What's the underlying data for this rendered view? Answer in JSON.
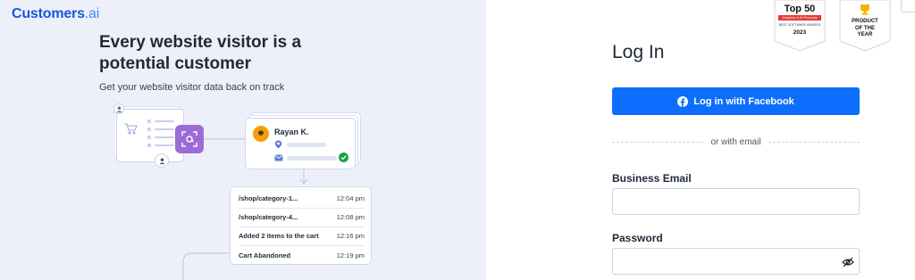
{
  "brand": {
    "name_main": "Customers",
    "name_suffix": ".ai"
  },
  "hero": {
    "headline": "Every website visitor is a potential customer",
    "subline": "Get your website visitor data back on track"
  },
  "illustration": {
    "profile_name": "Rayan K.",
    "activity_log": [
      {
        "event": "/shop/category-1...",
        "time": "12:04 pm"
      },
      {
        "event": "/shop/category-4...",
        "time": "12:08 pm"
      },
      {
        "event": "Added  2 items to the cart",
        "time": "12:16 pm"
      },
      {
        "event": "Cart Abandoned",
        "time": "12:19 pm"
      }
    ]
  },
  "badges": {
    "top50": {
      "title": "Top 50",
      "ribbon": "Analytics & AI Products",
      "sub": "BEST SOFTWARE AWARDS",
      "year": "2023"
    },
    "poty": {
      "line1": "PRODUCT",
      "line2": "OF THE",
      "line3": "YEAR"
    }
  },
  "login": {
    "title": "Log In",
    "facebook_button": "Log in with Facebook",
    "divider": "or with email",
    "email_label": "Business Email",
    "email_value": "",
    "password_label": "Password",
    "password_value": ""
  },
  "colors": {
    "brand_blue": "#1a56db",
    "facebook_blue": "#0d6efd",
    "left_bg": "#eef0f9",
    "accent_purple": "#9b6bd6",
    "badge_red": "#e53935"
  }
}
